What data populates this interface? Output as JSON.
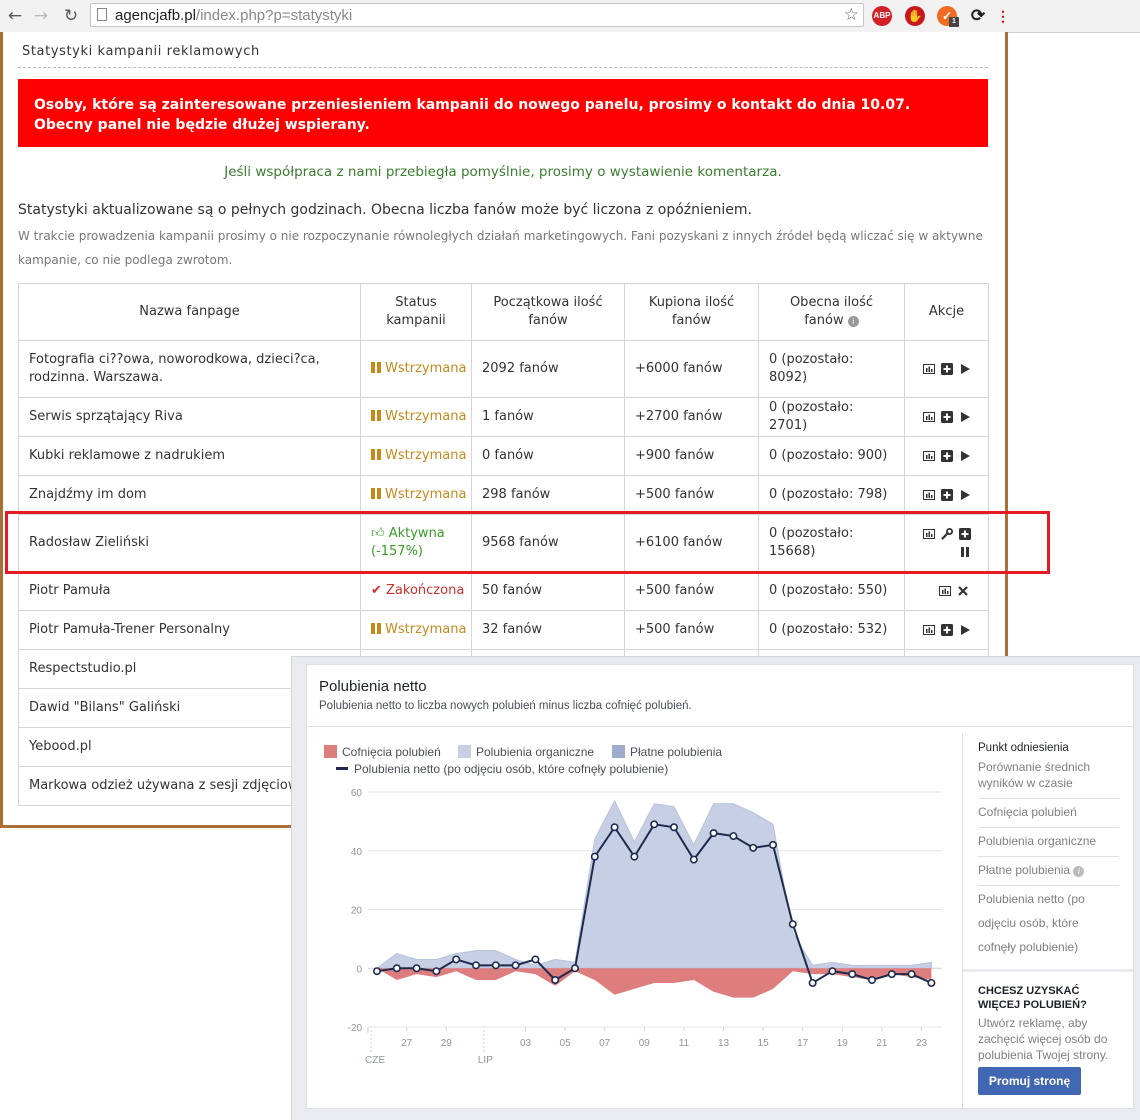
{
  "browser": {
    "url_host": "agencjafb.pl",
    "url_path": "/index.php?p=statystyki",
    "ext_abp": "ABP",
    "ext_badge": "1"
  },
  "page": {
    "title": "Statystyki kampanii reklamowych",
    "alert": "Osoby, które są zainteresowane przeniesieniem kampanii do nowego panelu, prosimy o kontakt do dnia 10.07. Obecny panel nie będzie dłużej wspierany.",
    "comment_request": "Jeśli współpraca z nami przebiegła pomyślnie, prosimy o wystawienie komentarza.",
    "info_main": "Statystyki aktualizowane są o pełnych godzinach. Obecna liczba fanów może być liczona z opóźnieniem.",
    "info_sub": "W trakcie prowadzenia kampanii prosimy o nie rozpoczynanie równoległych działań marketingowych. Fani pozyskani z innych źródeł będą wliczać się w aktywne kampanie, co nie podlega zwrotom."
  },
  "table": {
    "headers": {
      "name": "Nazwa fanpage",
      "status_l1": "Status",
      "status_l2": "kampanii",
      "initial_l1": "Początkowa ilość",
      "initial_l2": "fanów",
      "bought_l1": "Kupiona ilość",
      "bought_l2": "fanów",
      "current_l1": "Obecna ilość",
      "current_l2": "fanów",
      "actions": "Akcje"
    },
    "rows": [
      {
        "name": "Fotografia ci??owa, noworodkowa, dzieci?ca, rodzinna. Warszawa.",
        "status": "Wstrzymana",
        "status_extra": "",
        "initial": "2092 fanów",
        "bought": "+6000 fanów",
        "current": "0 (pozostało: 8092)"
      },
      {
        "name": "Serwis sprzątający Riva",
        "status": "Wstrzymana",
        "status_extra": "",
        "initial": "1 fanów",
        "bought": "+2700 fanów",
        "current": "0 (pozostało: 2701)"
      },
      {
        "name": "Kubki reklamowe z nadrukiem",
        "status": "Wstrzymana",
        "status_extra": "",
        "initial": "0 fanów",
        "bought": "+900 fanów",
        "current": "0 (pozostało: 900)"
      },
      {
        "name": "Znajdźmy im dom",
        "status": "Wstrzymana",
        "status_extra": "",
        "initial": "298 fanów",
        "bought": "+500 fanów",
        "current": "0 (pozostało: 798)"
      },
      {
        "name": "Radosław Zieliński",
        "status": "Aktywna",
        "status_extra": "(-157%)",
        "initial": "9568 fanów",
        "bought": "+6100 fanów",
        "current": "0 (pozostało: 15668)"
      },
      {
        "name": "Piotr Pamuła",
        "status": "Zakończona",
        "status_extra": "",
        "initial": "50 fanów",
        "bought": "+500 fanów",
        "current": "0 (pozostało: 550)"
      },
      {
        "name": "Piotr Pamuła-Trener Personalny",
        "status": "Wstrzymana",
        "status_extra": "",
        "initial": "32 fanów",
        "bought": "+500 fanów",
        "current": "0 (pozostało: 532)"
      },
      {
        "name": "Respectstudio.pl"
      },
      {
        "name": "Dawid \"Bilans\" Galiński"
      },
      {
        "name": "Yebood.pl"
      },
      {
        "name": "Markowa odzież używana z sesji zdjęciowych"
      }
    ]
  },
  "fb": {
    "title": "Polubienia netto",
    "subtitle": "Polubienia netto to liczba nowych polubień minus liczba cofnięć polubień.",
    "legend": {
      "unlikes": "Cofnięcia polubień",
      "organic": "Polubienia organiczne",
      "paid": "Płatne polubienia",
      "net": "Polubienia netto (po odjęciu osób, które cofnęły polubienie)"
    },
    "side": {
      "heading": "Punkt odniesienia",
      "compare": "Porównanie średnich wyników w czasie",
      "item1": "Cofnięcia polubień",
      "item2": "Polubienia organiczne",
      "item3": "Płatne polubienia",
      "item4": "Polubienia netto (po odjęciu osób, które cofnęły polubienie)"
    },
    "promo": {
      "heading": "CHCESZ UZYSKAĆ WIĘCEJ POLUBIEŃ?",
      "text": "Utwórz reklamę, aby zachęcić więcej osób do polubienia Twojej strony.",
      "button": "Promuj stronę"
    }
  },
  "colors": {
    "alert_bg": "#ff0000",
    "unlikes": "#de7d7d",
    "organic": "#c6cfe3",
    "paid": "#9fabcc",
    "net_line": "#1d2b4f",
    "highlight": "#e41b23"
  },
  "chart_data": {
    "type": "area",
    "title": "Polubienia netto",
    "ylim": [
      -20,
      60
    ],
    "yticks": [
      60,
      40,
      20,
      0,
      -20
    ],
    "x_tick_labels": [
      "27",
      "29",
      "03",
      "05",
      "07",
      "09",
      "11",
      "13",
      "15",
      "17",
      "19",
      "21",
      "23"
    ],
    "x_tick_index": [
      1.5,
      3.5,
      7.5,
      9.5,
      11.5,
      13.5,
      15.5,
      17.5,
      19.5,
      21.5,
      23.5,
      25.5,
      27.5
    ],
    "month_labels": [
      "CZE",
      "LIP"
    ],
    "month_index": [
      0,
      5.7
    ],
    "grid": true,
    "series": [
      {
        "name": "Cofnięcia polubień",
        "values": [
          0,
          -4,
          -2,
          -3,
          -1,
          -4,
          -4,
          -1,
          -2,
          -6,
          -1,
          -4,
          -9,
          -7,
          -5,
          -5,
          -4,
          -8,
          -10,
          -10,
          -7,
          -1,
          -2,
          -2,
          -3,
          -4,
          -2,
          -3,
          -4
        ]
      },
      {
        "name": "Polubienia organiczne",
        "values": [
          0,
          5,
          3,
          3,
          5,
          6,
          6,
          3,
          1,
          3,
          2,
          44,
          57,
          43,
          56,
          55,
          42,
          56,
          56,
          53,
          49,
          12,
          1,
          2,
          1,
          1,
          1,
          1,
          2
        ]
      },
      {
        "name": "Polubienia netto (po odjęciu osób, które cofnęły polubienie)",
        "values": [
          -1,
          0,
          0,
          -1,
          3,
          1,
          1,
          1,
          3,
          -4,
          0,
          38,
          48,
          38,
          49,
          48,
          37,
          46,
          45,
          41,
          42,
          15,
          -5,
          -1,
          -2,
          -4,
          -2,
          -2,
          -5
        ]
      }
    ]
  }
}
